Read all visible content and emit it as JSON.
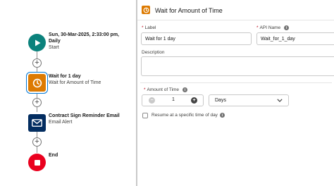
{
  "flow": {
    "start": {
      "title": "Sun, 30-Mar-2025, 2:33:00 pm,",
      "title2": "Daily",
      "subtitle": "Start"
    },
    "wait": {
      "title": "Wait for 1 day",
      "subtitle": "Wait for Amount of Time"
    },
    "email": {
      "title": "Contract Sign Reminder Email",
      "subtitle": "Email Alert"
    },
    "end": {
      "title": "End"
    },
    "add_symbol": "+"
  },
  "panel": {
    "title": "Wait for Amount of Time",
    "label_field": {
      "label": "Label",
      "value": "Wait for 1 day"
    },
    "api_field": {
      "label": "API Name",
      "value": "Wait_for_1_day"
    },
    "description": {
      "label": "Description",
      "value": ""
    },
    "amount": {
      "label": "Amount of Time",
      "value": "1",
      "minus": "−",
      "plus": "+"
    },
    "unit": {
      "value": "Days"
    },
    "resume": {
      "label": "Resume at a specific time of day",
      "checked": false
    },
    "required_marker": "*",
    "info_glyph": "i"
  },
  "colors": {
    "start": "#0b827c",
    "wait": "#dd7a01",
    "email": "#032d60",
    "end": "#ea001e",
    "selection": "#0176d3"
  }
}
